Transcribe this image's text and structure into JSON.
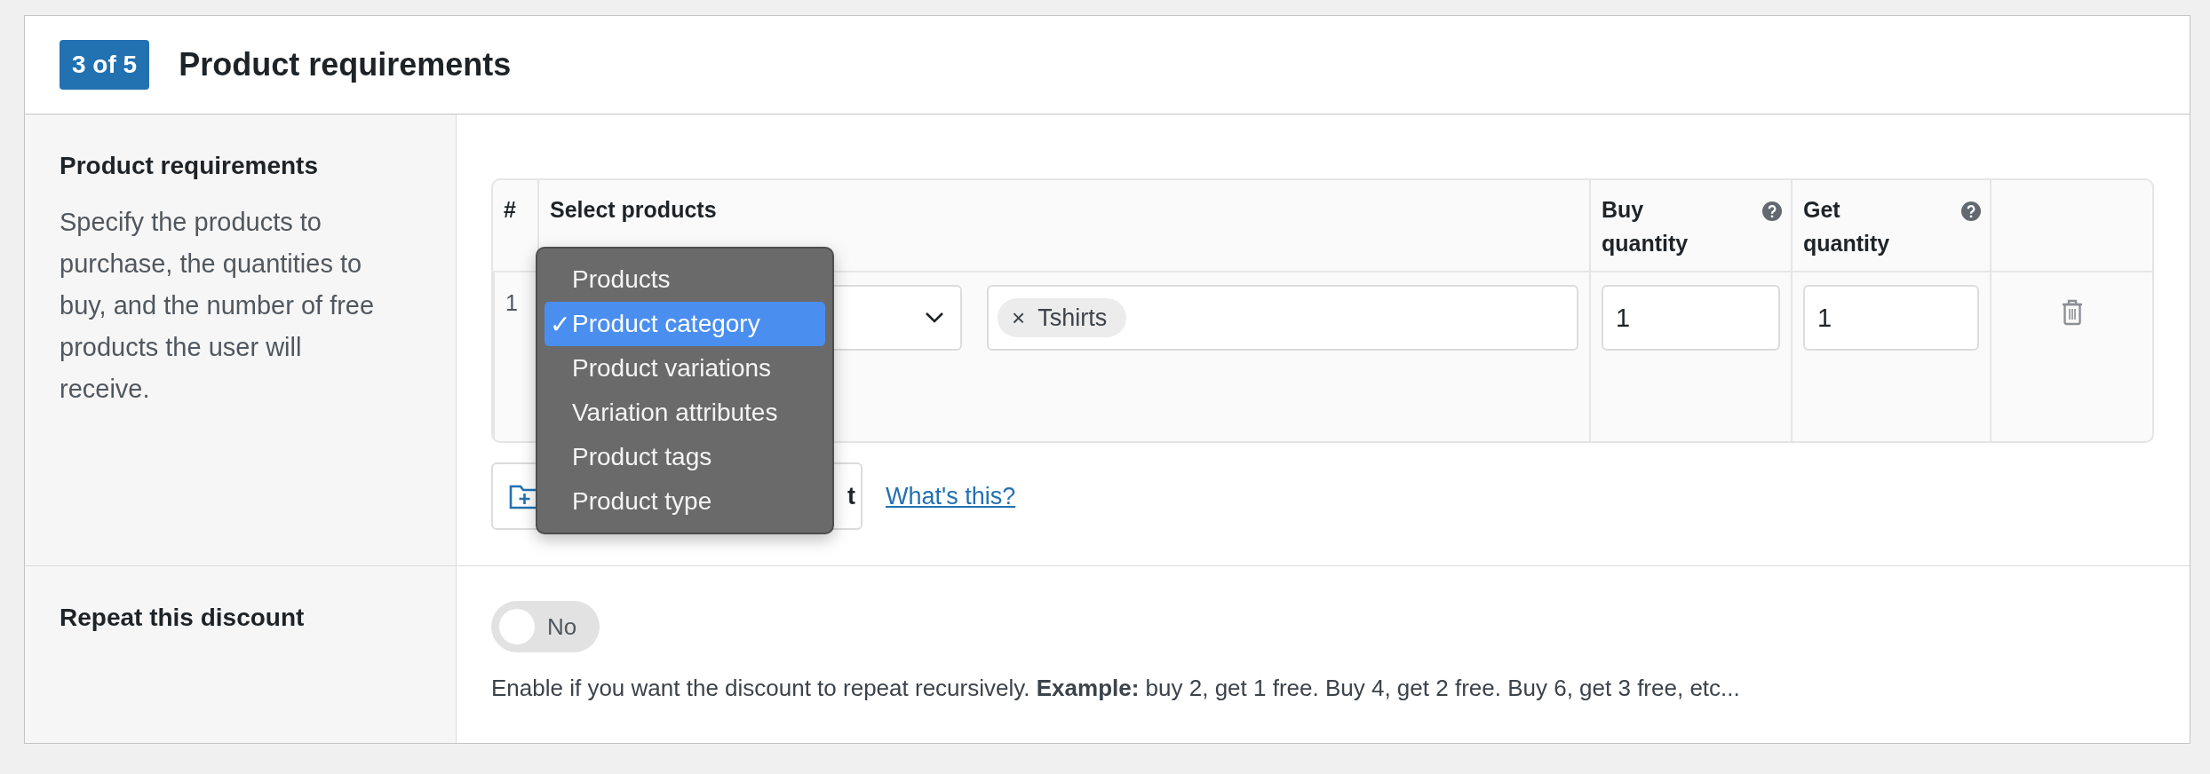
{
  "step_badge": "3 of 5",
  "title": "Product requirements",
  "requirements": {
    "label": "Product requirements",
    "description": "Specify the products to purchase, the quantities to buy, and the number of free products the user will receive.",
    "table": {
      "columns": [
        {
          "label": "#",
          "help": false
        },
        {
          "label": "Select products",
          "help": false
        },
        {
          "label": "Buy quantity",
          "help": true
        },
        {
          "label": "Get quantity",
          "help": true
        }
      ],
      "rows": [
        {
          "number": "1",
          "tags": [
            {
              "label": "Tshirts",
              "remove": "×"
            }
          ],
          "buy": "1",
          "get": "1"
        }
      ]
    },
    "dropdown": {
      "options": [
        {
          "label": "Products",
          "selected": false
        },
        {
          "label": "Product category",
          "selected": true
        },
        {
          "label": "Product variations",
          "selected": false
        },
        {
          "label": "Variation attributes",
          "selected": false
        },
        {
          "label": "Product tags",
          "selected": false
        },
        {
          "label": "Product type",
          "selected": false
        }
      ],
      "check": "✓"
    },
    "add_button": {
      "label": "t"
    },
    "help_link": "What's this?"
  },
  "repeat": {
    "label": "Repeat this discount",
    "toggle": {
      "on": false,
      "label": "No"
    },
    "description": "Enable if you want the discount to repeat recursively. **Example:** buy 2, get 1 free. Buy 4, get 2 free. Buy 6, get 3 free, etc..."
  }
}
